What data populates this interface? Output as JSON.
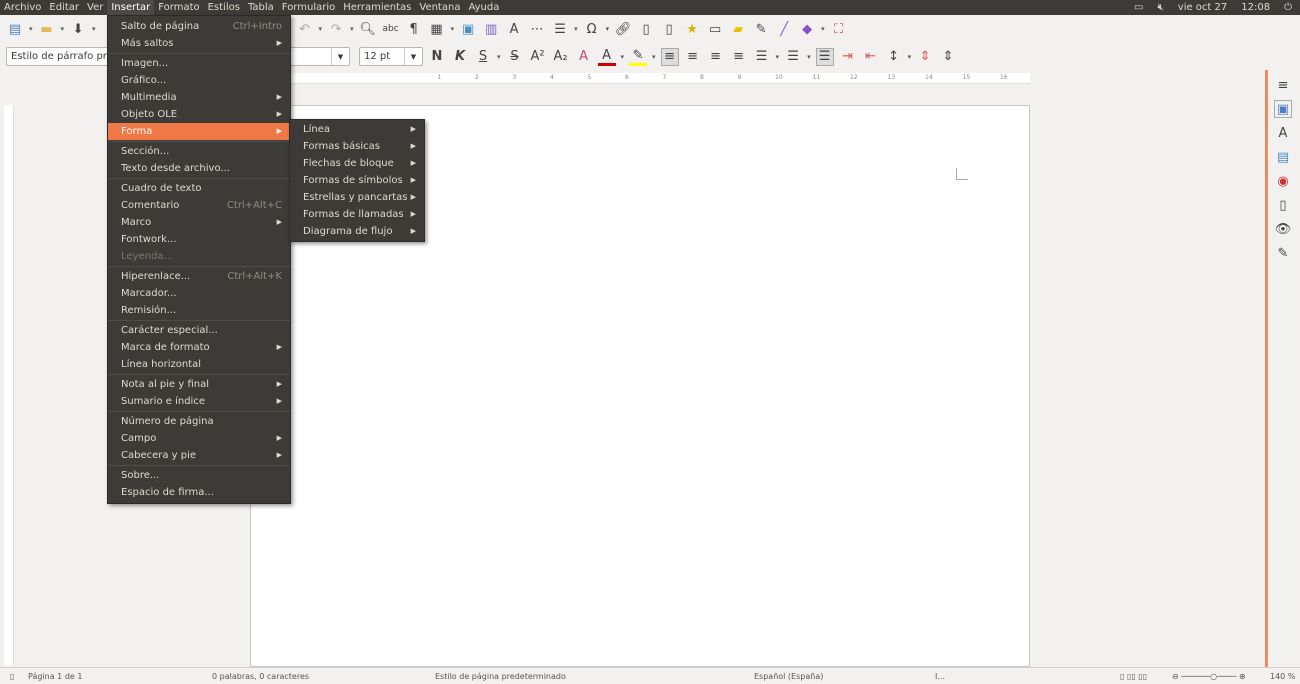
{
  "menubar": [
    "Archivo",
    "Editar",
    "Ver",
    "Insertar",
    "Formato",
    "Estilos",
    "Tabla",
    "Formulario",
    "Herramientas",
    "Ventana",
    "Ayuda"
  ],
  "tray": {
    "date": "vie oct 27",
    "time": "12:08"
  },
  "toolbar": {
    "para_style": "Estilo de párrafo pre",
    "font_size": "12 pt"
  },
  "insert_menu": [
    {
      "label": "Salto de página",
      "shortcut": "Ctrl+Intro"
    },
    {
      "label": "Más saltos",
      "submenu": true
    },
    {
      "sep": true
    },
    {
      "label": "Imagen..."
    },
    {
      "label": "Gráfico..."
    },
    {
      "label": "Multimedia",
      "submenu": true
    },
    {
      "label": "Objeto OLE",
      "submenu": true
    },
    {
      "label": "Forma",
      "submenu": true,
      "highlighted": true
    },
    {
      "sep": true
    },
    {
      "label": "Sección..."
    },
    {
      "label": "Texto desde archivo..."
    },
    {
      "sep": true
    },
    {
      "label": "Cuadro de texto"
    },
    {
      "label": "Comentario",
      "shortcut": "Ctrl+Alt+C"
    },
    {
      "label": "Marco",
      "submenu": true
    },
    {
      "label": "Fontwork..."
    },
    {
      "label": "Leyenda...",
      "disabled": true
    },
    {
      "sep": true
    },
    {
      "label": "Hiperenlace...",
      "shortcut": "Ctrl+Alt+K"
    },
    {
      "label": "Marcador..."
    },
    {
      "label": "Remisión..."
    },
    {
      "sep": true
    },
    {
      "label": "Carácter especial..."
    },
    {
      "label": "Marca de formato",
      "submenu": true
    },
    {
      "label": "Línea horizontal"
    },
    {
      "sep": true
    },
    {
      "label": "Nota al pie y final",
      "submenu": true
    },
    {
      "label": "Sumario e índice",
      "submenu": true
    },
    {
      "sep": true
    },
    {
      "label": "Número de página"
    },
    {
      "label": "Campo",
      "submenu": true
    },
    {
      "label": "Cabecera y pie",
      "submenu": true
    },
    {
      "sep": true
    },
    {
      "label": "Sobre..."
    },
    {
      "label": "Espacio de firma..."
    }
  ],
  "shape_submenu": [
    "Línea",
    "Formas básicas",
    "Flechas de bloque",
    "Formas de símbolos",
    "Estrellas y pancartas",
    "Formas de llamadas",
    "Diagrama de flujo"
  ],
  "status": {
    "page": "Página 1 de 1",
    "words": "0 palabras, 0 caracteres",
    "page_style": "Estilo de página predeterminado",
    "language": "Español (España)",
    "zoom": "140 %",
    "zoom_level": 140
  },
  "colors": {
    "accent": "#f07746",
    "menubar": "#3c3b37"
  }
}
